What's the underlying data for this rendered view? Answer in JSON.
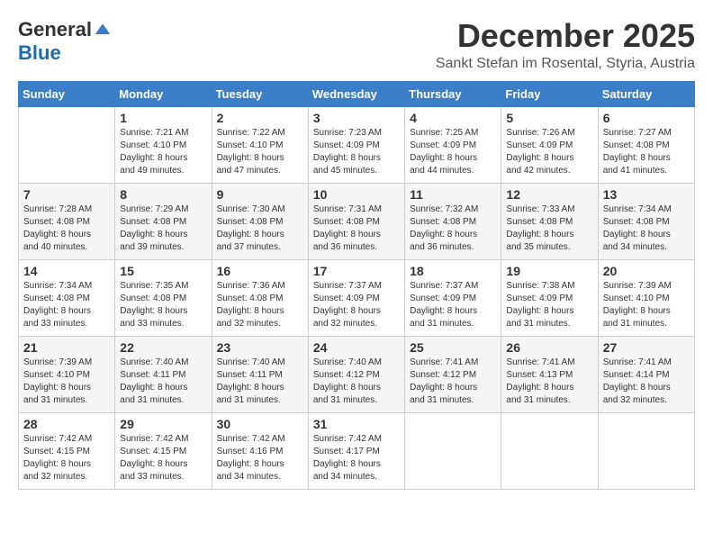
{
  "logo": {
    "general": "General",
    "blue": "Blue"
  },
  "title": {
    "month": "December 2025",
    "location": "Sankt Stefan im Rosental, Styria, Austria"
  },
  "weekdays": [
    "Sunday",
    "Monday",
    "Tuesday",
    "Wednesday",
    "Thursday",
    "Friday",
    "Saturday"
  ],
  "weeks": [
    [
      {
        "day": "",
        "info": ""
      },
      {
        "day": "1",
        "info": "Sunrise: 7:21 AM\nSunset: 4:10 PM\nDaylight: 8 hours\nand 49 minutes."
      },
      {
        "day": "2",
        "info": "Sunrise: 7:22 AM\nSunset: 4:10 PM\nDaylight: 8 hours\nand 47 minutes."
      },
      {
        "day": "3",
        "info": "Sunrise: 7:23 AM\nSunset: 4:09 PM\nDaylight: 8 hours\nand 45 minutes."
      },
      {
        "day": "4",
        "info": "Sunrise: 7:25 AM\nSunset: 4:09 PM\nDaylight: 8 hours\nand 44 minutes."
      },
      {
        "day": "5",
        "info": "Sunrise: 7:26 AM\nSunset: 4:09 PM\nDaylight: 8 hours\nand 42 minutes."
      },
      {
        "day": "6",
        "info": "Sunrise: 7:27 AM\nSunset: 4:08 PM\nDaylight: 8 hours\nand 41 minutes."
      }
    ],
    [
      {
        "day": "7",
        "info": "Sunrise: 7:28 AM\nSunset: 4:08 PM\nDaylight: 8 hours\nand 40 minutes."
      },
      {
        "day": "8",
        "info": "Sunrise: 7:29 AM\nSunset: 4:08 PM\nDaylight: 8 hours\nand 39 minutes."
      },
      {
        "day": "9",
        "info": "Sunrise: 7:30 AM\nSunset: 4:08 PM\nDaylight: 8 hours\nand 37 minutes."
      },
      {
        "day": "10",
        "info": "Sunrise: 7:31 AM\nSunset: 4:08 PM\nDaylight: 8 hours\nand 36 minutes."
      },
      {
        "day": "11",
        "info": "Sunrise: 7:32 AM\nSunset: 4:08 PM\nDaylight: 8 hours\nand 36 minutes."
      },
      {
        "day": "12",
        "info": "Sunrise: 7:33 AM\nSunset: 4:08 PM\nDaylight: 8 hours\nand 35 minutes."
      },
      {
        "day": "13",
        "info": "Sunrise: 7:34 AM\nSunset: 4:08 PM\nDaylight: 8 hours\nand 34 minutes."
      }
    ],
    [
      {
        "day": "14",
        "info": "Sunrise: 7:34 AM\nSunset: 4:08 PM\nDaylight: 8 hours\nand 33 minutes."
      },
      {
        "day": "15",
        "info": "Sunrise: 7:35 AM\nSunset: 4:08 PM\nDaylight: 8 hours\nand 33 minutes."
      },
      {
        "day": "16",
        "info": "Sunrise: 7:36 AM\nSunset: 4:08 PM\nDaylight: 8 hours\nand 32 minutes."
      },
      {
        "day": "17",
        "info": "Sunrise: 7:37 AM\nSunset: 4:09 PM\nDaylight: 8 hours\nand 32 minutes."
      },
      {
        "day": "18",
        "info": "Sunrise: 7:37 AM\nSunset: 4:09 PM\nDaylight: 8 hours\nand 31 minutes."
      },
      {
        "day": "19",
        "info": "Sunrise: 7:38 AM\nSunset: 4:09 PM\nDaylight: 8 hours\nand 31 minutes."
      },
      {
        "day": "20",
        "info": "Sunrise: 7:39 AM\nSunset: 4:10 PM\nDaylight: 8 hours\nand 31 minutes."
      }
    ],
    [
      {
        "day": "21",
        "info": "Sunrise: 7:39 AM\nSunset: 4:10 PM\nDaylight: 8 hours\nand 31 minutes."
      },
      {
        "day": "22",
        "info": "Sunrise: 7:40 AM\nSunset: 4:11 PM\nDaylight: 8 hours\nand 31 minutes."
      },
      {
        "day": "23",
        "info": "Sunrise: 7:40 AM\nSunset: 4:11 PM\nDaylight: 8 hours\nand 31 minutes."
      },
      {
        "day": "24",
        "info": "Sunrise: 7:40 AM\nSunset: 4:12 PM\nDaylight: 8 hours\nand 31 minutes."
      },
      {
        "day": "25",
        "info": "Sunrise: 7:41 AM\nSunset: 4:12 PM\nDaylight: 8 hours\nand 31 minutes."
      },
      {
        "day": "26",
        "info": "Sunrise: 7:41 AM\nSunset: 4:13 PM\nDaylight: 8 hours\nand 31 minutes."
      },
      {
        "day": "27",
        "info": "Sunrise: 7:41 AM\nSunset: 4:14 PM\nDaylight: 8 hours\nand 32 minutes."
      }
    ],
    [
      {
        "day": "28",
        "info": "Sunrise: 7:42 AM\nSunset: 4:15 PM\nDaylight: 8 hours\nand 32 minutes."
      },
      {
        "day": "29",
        "info": "Sunrise: 7:42 AM\nSunset: 4:15 PM\nDaylight: 8 hours\nand 33 minutes."
      },
      {
        "day": "30",
        "info": "Sunrise: 7:42 AM\nSunset: 4:16 PM\nDaylight: 8 hours\nand 34 minutes."
      },
      {
        "day": "31",
        "info": "Sunrise: 7:42 AM\nSunset: 4:17 PM\nDaylight: 8 hours\nand 34 minutes."
      },
      {
        "day": "",
        "info": ""
      },
      {
        "day": "",
        "info": ""
      },
      {
        "day": "",
        "info": ""
      }
    ]
  ]
}
